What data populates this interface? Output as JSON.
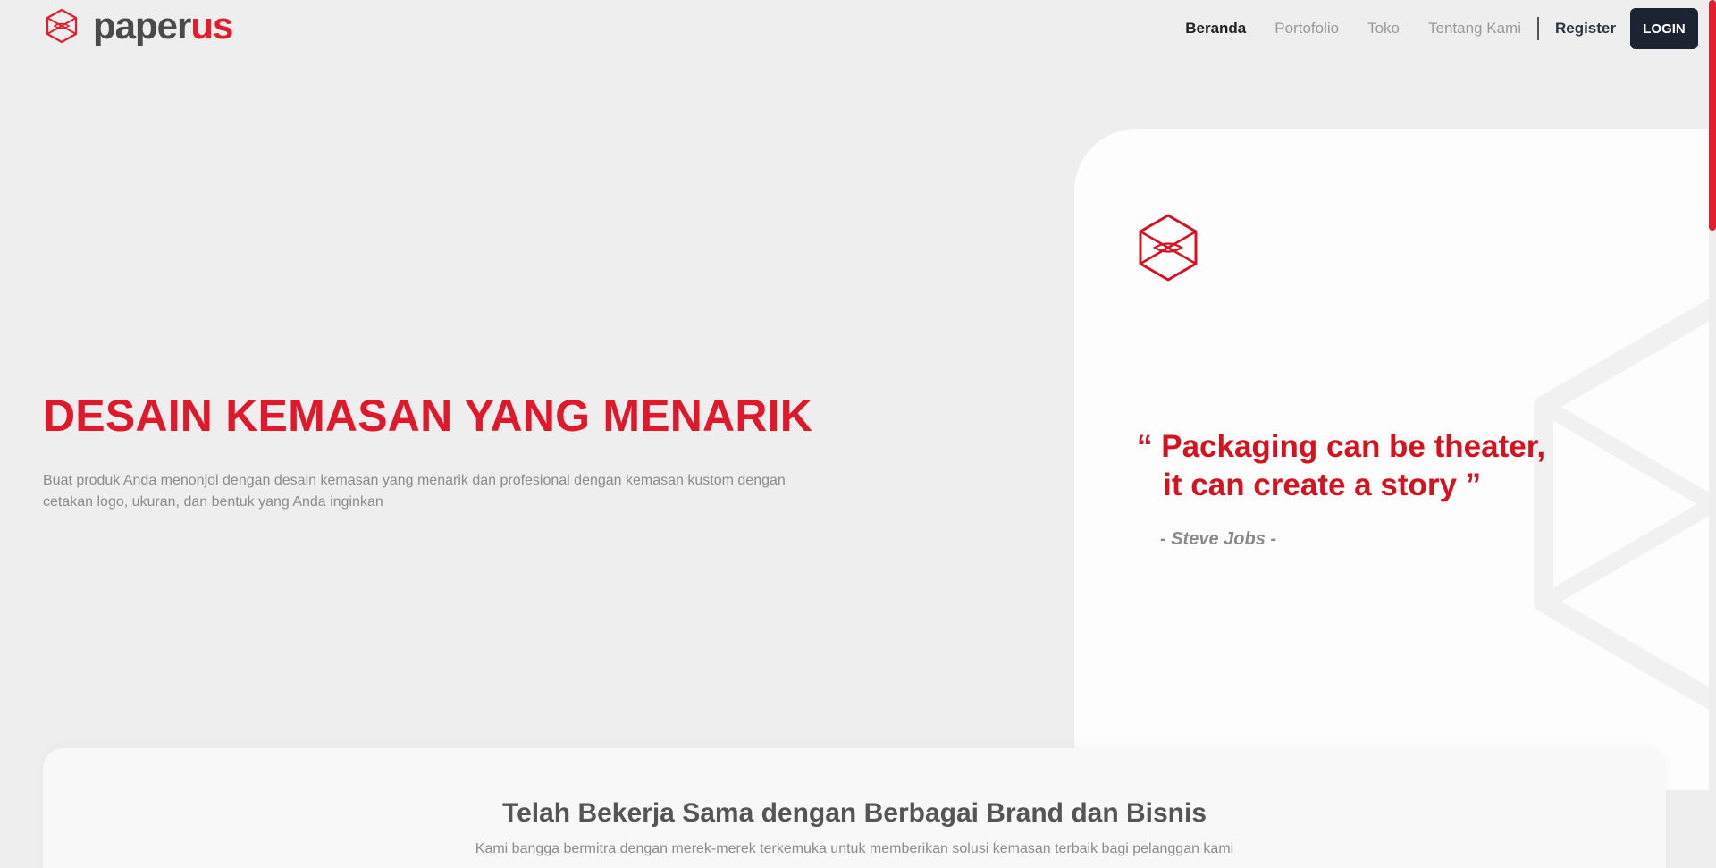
{
  "brand": {
    "name_part1": "paper",
    "name_part2": "us",
    "accent_color": "#e01e2d"
  },
  "nav": {
    "links": [
      "Beranda",
      "Portofolio",
      "Toko",
      "Tentang Kami"
    ],
    "register": "Register",
    "login": "LOGIN"
  },
  "hero": {
    "title": "DESAIN KEMASAN YANG MENARIK",
    "description": "Buat produk Anda menonjol dengan desain kemasan yang menarik dan profesional dengan kemasan kustom dengan cetakan logo, ukuran, dan bentuk yang Anda inginkan"
  },
  "quote": {
    "line1": "“ Packaging can be theater,",
    "line2": "   it can create a story ”",
    "author": "- Steve Jobs -"
  },
  "partners": {
    "title": "Telah Bekerja Sama dengan Berbagai Brand dan Bisnis",
    "subtitle": "Kami bangga bermitra dengan merek-merek terkemuka untuk memberikan solusi kemasan terbaik bagi pelanggan kami"
  },
  "icons": {
    "brand": "hexagon-box-logo-icon",
    "card": "hexagon-box-logo-icon",
    "background": "hexagon-watermark-icon"
  }
}
